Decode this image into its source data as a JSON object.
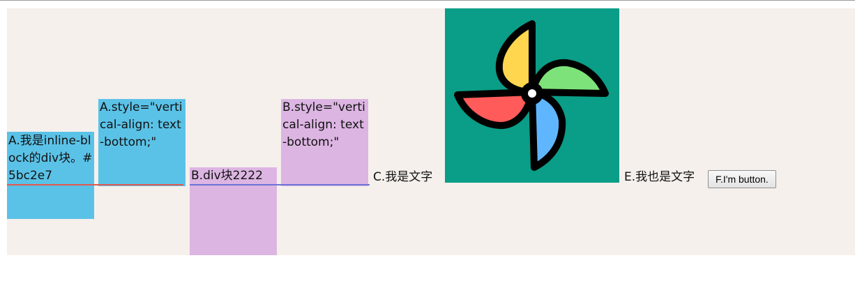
{
  "boxes": {
    "a1_text": "A.我是inline-block的div块。#5bc2e7",
    "a2_text": "A.style=\"vertical-align: text-bottom;\"",
    "b1_text": "B.div块2222",
    "b2_text": "B.style=\"vertical-align: text-bottom;\""
  },
  "texts": {
    "c_text": "C.我是文字",
    "e_text": "E.我也是文字"
  },
  "button": {
    "label": "F.I'm button."
  },
  "image": {
    "icon": "pinwheel-icon"
  },
  "colors": {
    "box_a": "#5bc2e7",
    "box_b": "#dcb5e2",
    "image_bg": "#0a9d87",
    "area_bg": "#f5f0ec",
    "baseline_red": "#e1584f",
    "baseline_blue": "#6c74d6",
    "blade_yellow": "#ffd64d",
    "blade_green": "#7ee27a",
    "blade_blue": "#5fb6ff",
    "blade_red": "#ff5b5b"
  }
}
